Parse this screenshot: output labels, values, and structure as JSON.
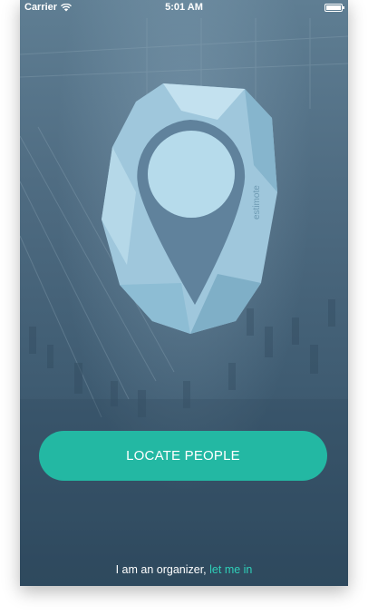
{
  "status_bar": {
    "carrier": "Carrier",
    "time": "5:01 AM",
    "icons": [
      "wifi-icon",
      "battery-icon"
    ]
  },
  "logo": {
    "icon": "location-pin-beacon-icon",
    "vertical_text": "estimote"
  },
  "main": {
    "locate_button_label": "LOCATE PEOPLE"
  },
  "footer": {
    "text": "I am an organizer,",
    "link_text": "let me in"
  },
  "colors": {
    "accent": "#23b8a3",
    "link": "#2fd0b9",
    "background": "#4d6a80",
    "logo": "#a9d0e4"
  }
}
